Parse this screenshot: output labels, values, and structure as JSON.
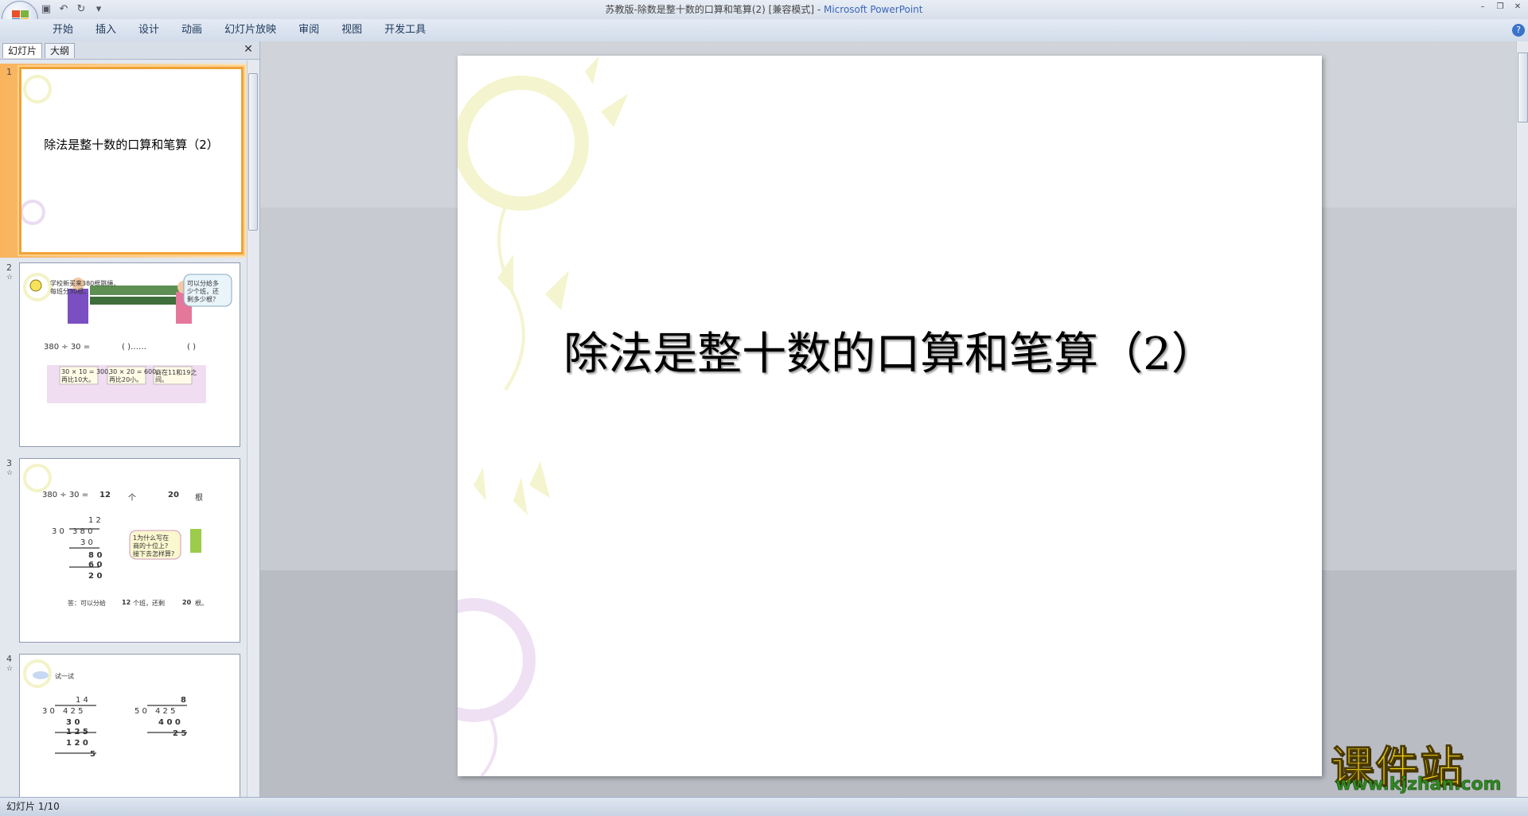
{
  "window": {
    "title_doc": "苏教版-除数是整十数的口算和笔算(2) [兼容模式] - ",
    "title_app": "Microsoft PowerPoint"
  },
  "ribbon": {
    "tabs": [
      "开始",
      "插入",
      "设计",
      "动画",
      "幻灯片放映",
      "审阅",
      "视图",
      "开发工具"
    ]
  },
  "panel": {
    "tab_slides": "幻灯片",
    "tab_outline": "大纲"
  },
  "slides": [
    {
      "num": "1",
      "title": "除法是整十数的口算和笔算（2）"
    },
    {
      "num": "2",
      "lines": [
        "学校新买来380根跳绳，",
        "每班分30根。",
        "可以分给多",
        "少个班，还",
        "剩多少根？",
        "380 ÷ 30 =",
        "(      )……",
        "(      )",
        "30 × 10 = 300,",
        "再比10大。",
        "30 × 20 = 600,",
        "再比20小。",
        "商在11和19之",
        "间。"
      ]
    },
    {
      "num": "3",
      "lines": [
        "380 ÷ 30 =",
        "12",
        "个",
        "20",
        "根",
        "1 2",
        "3 0",
        "3 8 0",
        "3 0",
        "8 0",
        "6 0",
        "2 0",
        "1为什么写在",
        "商的十位上?",
        "接下去怎样算?",
        "答：可以分给",
        "12",
        "个班，还剩",
        "20",
        "根。"
      ]
    },
    {
      "num": "4",
      "lines": [
        "试一试",
        "1 4",
        "3 0",
        "4 2 5",
        "3 0",
        "1 2 5",
        "1 2 0",
        "5",
        "8",
        "5 0",
        "4 2 5",
        "4 0 0",
        "2 5"
      ]
    }
  ],
  "main_slide": {
    "title": "除法是整十数的口算和笔算（2）"
  },
  "status": {
    "text": "幻灯片 1/10"
  },
  "watermark": {
    "cn": "课件站",
    "url": "www.kjzhan.com"
  },
  "colors": {
    "selected_border": "#f0a238",
    "app_title": "#3b67b8"
  }
}
